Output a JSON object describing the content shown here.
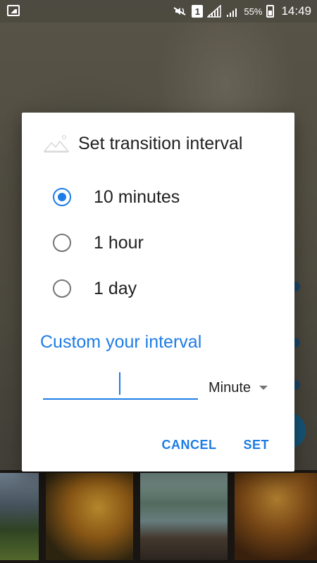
{
  "status_bar": {
    "sim_slot": "1",
    "battery_percent": "55%",
    "time": "14:49",
    "icons": [
      "gallery-icon",
      "mute-icon",
      "sim-icon",
      "signal-icon",
      "signal-icon",
      "battery-charging-icon"
    ]
  },
  "dialog": {
    "title": "Set transition interval",
    "title_icon": "image-icon",
    "options": [
      {
        "label": "10 minutes",
        "selected": true
      },
      {
        "label": "1 hour",
        "selected": false
      },
      {
        "label": "1 day",
        "selected": false
      }
    ],
    "custom_heading": "Custom your interval",
    "custom_input": {
      "value": "",
      "placeholder": ""
    },
    "unit": {
      "selected": "Minute"
    },
    "buttons": {
      "cancel": "CANCEL",
      "set": "SET"
    }
  },
  "colors": {
    "accent": "#1e7ce6",
    "dialog_bg": "#ffffff",
    "text": "#212121"
  }
}
